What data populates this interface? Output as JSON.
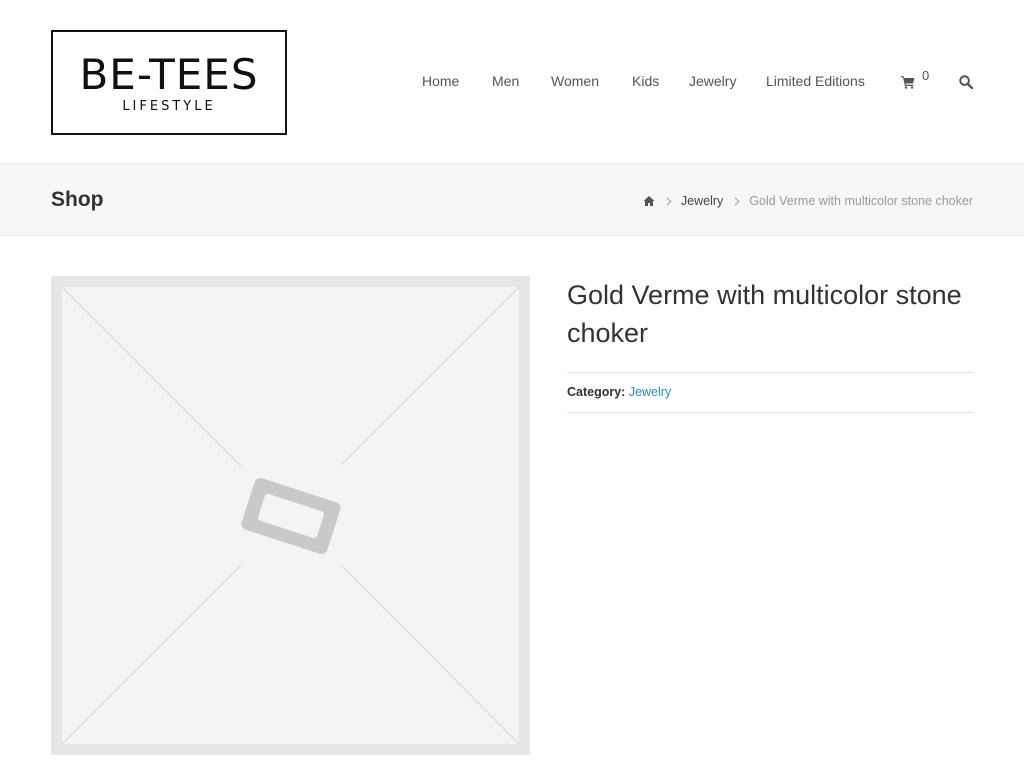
{
  "brand": {
    "name": "BE-TEES",
    "tagline": "LIFESTYLE"
  },
  "nav": {
    "items": [
      {
        "label": "Home"
      },
      {
        "label": "Men"
      },
      {
        "label": "Women"
      },
      {
        "label": "Kids"
      },
      {
        "label": "Jewelry"
      },
      {
        "label": "Limited Editions"
      }
    ],
    "cart_icon": "shopping-cart-icon",
    "cart_count": "0",
    "search_icon": "search-icon"
  },
  "title_bar": {
    "title": "Shop",
    "breadcrumb": {
      "home_icon": "home-icon",
      "separator_icon": "chevron-right-icon",
      "category": "Jewelry",
      "current": "Gold Verme with multicolor stone choker"
    }
  },
  "product": {
    "image_icon": "placeholder-image-icon",
    "title": "Gold Verme with multicolor stone choker",
    "category_label": "Category:",
    "category_value": "Jewelry"
  },
  "colors": {
    "link": "#2a8bc5",
    "text": "#333333",
    "muted": "#9a9a9a",
    "title_bar_bg": "#f7f7f7"
  }
}
